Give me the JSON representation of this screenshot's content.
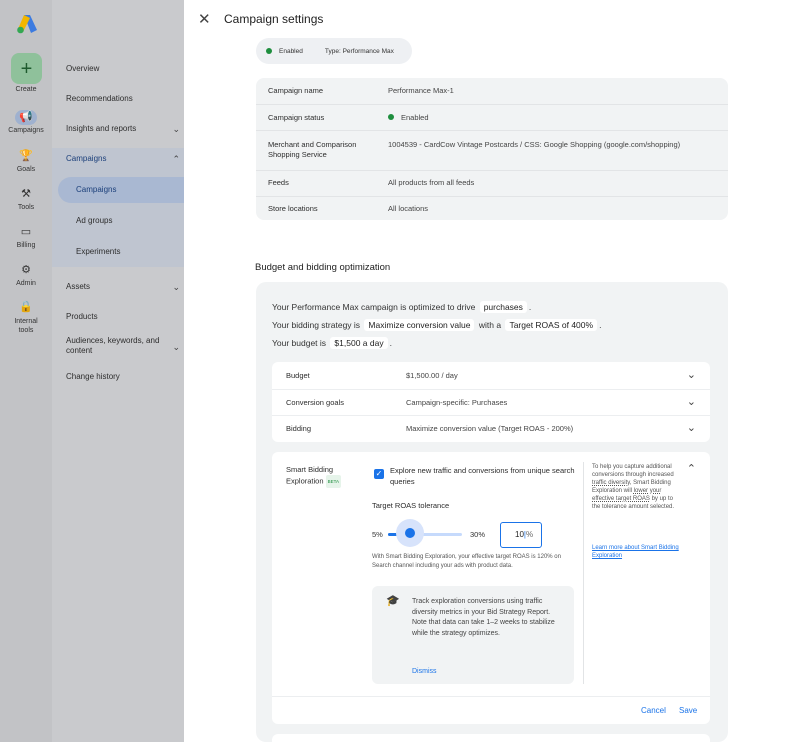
{
  "rail": {
    "create": "Create",
    "items": [
      {
        "label": "Campaigns",
        "icon": "megaphone-icon"
      },
      {
        "label": "Goals",
        "icon": "trophy-icon"
      },
      {
        "label": "Tools",
        "icon": "tools-icon"
      },
      {
        "label": "Billing",
        "icon": "credit-card-icon"
      },
      {
        "label": "Admin",
        "icon": "gear-icon"
      },
      {
        "label": "Internal tools",
        "icon": "lock-icon"
      }
    ]
  },
  "nav": {
    "overview": "Overview",
    "recommendations": "Recommendations",
    "insights": "Insights and reports",
    "campaigns": "Campaigns",
    "sub_campaigns": "Campaigns",
    "ad_groups": "Ad groups",
    "experiments": "Experiments",
    "assets": "Assets",
    "products": "Products",
    "audiences": "Audiences, keywords, and content",
    "change_history": "Change history"
  },
  "panel": {
    "title": "Campaign settings",
    "chip_status": "Enabled",
    "chip_type": "Type: Performance Max",
    "settings": {
      "campaign_name_label": "Campaign name",
      "campaign_name": "Performance Max-1",
      "campaign_status_label": "Campaign status",
      "campaign_status": "Enabled",
      "merchant_label": "Merchant and Comparison Shopping Service",
      "merchant": "1004539 - CardCow Vintage Postcards / CSS: Google Shopping (google.com/shopping)",
      "feeds_label": "Feeds",
      "feeds": "All products from all feeds",
      "store_label": "Store locations",
      "store": "All locations"
    },
    "section_title": "Budget and bidding optimization",
    "summary": {
      "l1_pre": "Your Performance Max campaign is optimized to drive",
      "l1_val": "purchases",
      "l2_pre": "Your bidding strategy is",
      "l2_val": "Maximize conversion value",
      "l2_mid": "with a",
      "l2_val2": "Target ROAS of 400%",
      "l3_pre": "Your budget is",
      "l3_val": "$1,500 a day"
    },
    "accordion": [
      {
        "label": "Budget",
        "value": "$1,500.00 / day"
      },
      {
        "label": "Conversion goals",
        "value": "Campaign-specific: Purchases"
      },
      {
        "label": "Bidding",
        "value": "Maximize conversion value (Target ROAS - 200%)"
      }
    ],
    "sbe": {
      "title": "Smart Bidding Exploration",
      "beta": "BETA",
      "checkbox_label": "Explore new traffic and conversions from unique search queries",
      "tolerance_label": "Target ROAS tolerance",
      "min": "5%",
      "max": "30%",
      "value": "10",
      "unit": "%",
      "slider_fraction": 0.2,
      "note": "With Smart Bidding Exploration, your effective target ROAS is 120% on Search channel including your ads with product data.",
      "track_text": "Track exploration conversions using traffic diversity metrics in your Bid Strategy Report. Note that data can take 1–2 weeks to stabilize while the strategy optimizes.",
      "dismiss": "Dismiss",
      "help_1": "To help you capture additional conversions through increased",
      "help_u1": "traffic diversity",
      "help_2": ", Smart Bidding Exploration will",
      "help_u2": "lower your effective target ROAS",
      "help_3": "by up to the tolerance amount selected.",
      "learn_more": "Learn more about Smart Bidding Exploration",
      "cancel": "Cancel",
      "save": "Save"
    }
  }
}
